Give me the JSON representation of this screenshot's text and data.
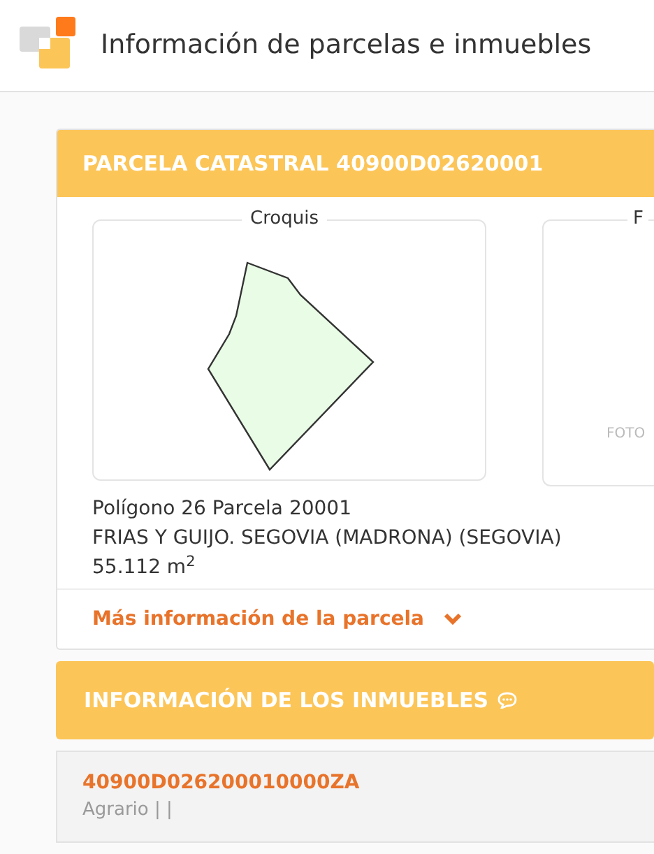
{
  "window": {
    "title": "Información de parcelas e inmuebles"
  },
  "parcel": {
    "title": "PARCELA CATASTRAL 40900D02620001",
    "sketch_label": "Croquis",
    "photo_label": "F",
    "photo_caption": "FOTO",
    "location": "Polígono 26 Parcela 20001",
    "address": "FRIAS Y GUIJO. SEGOVIA (MADRONA) (SEGOVIA)",
    "area": "55.112 m$^{2}$",
    "more_link": "Más información de la parcela",
    "expanded": false
  },
  "properties": {
    "title": "INFORMACIÓN DE LOS INMUEBLES",
    "items": [
      {
        "reference": "40900D026200010000ZA",
        "use": "Agrario | |"
      }
    ]
  }
}
